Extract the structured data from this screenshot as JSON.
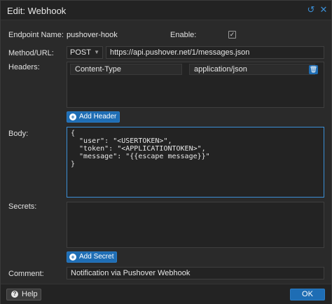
{
  "window": {
    "title": "Edit: Webhook"
  },
  "fields": {
    "endpoint_label": "Endpoint Name:",
    "endpoint_value": "pushover-hook",
    "enable_label": "Enable:",
    "enable_checked": true,
    "method_url_label": "Method/URL:",
    "method_value": "POST",
    "url_value": "https://api.pushover.net/1/messages.json",
    "headers_label": "Headers:",
    "body_label": "Body:",
    "secrets_label": "Secrets:",
    "comment_label": "Comment:",
    "comment_value": "Notification via Pushover Webhook"
  },
  "headers": [
    {
      "key": "Content-Type",
      "value": "application/json"
    }
  ],
  "buttons": {
    "add_header": "Add Header",
    "add_secret": "Add Secret",
    "help": "Help",
    "ok": "OK"
  },
  "body_text": "{\n  \"user\": \"<USERTOKEN>\",\n  \"token\": \"<APPLICATIONTOKEN>\",\n  \"message\": \"{{escape message}}\"\n}",
  "icons": {
    "reset": "reset-icon",
    "close": "close-icon",
    "trash": "trash-icon",
    "plus": "plus-circle-icon",
    "help": "question-circle-icon",
    "check": "check-icon",
    "chevron": "chevron-down-icon"
  },
  "colors": {
    "accent": "#1e6db4",
    "background": "#2a2a2a",
    "field_bg": "#232323",
    "focus_border": "#3b8fd6"
  }
}
